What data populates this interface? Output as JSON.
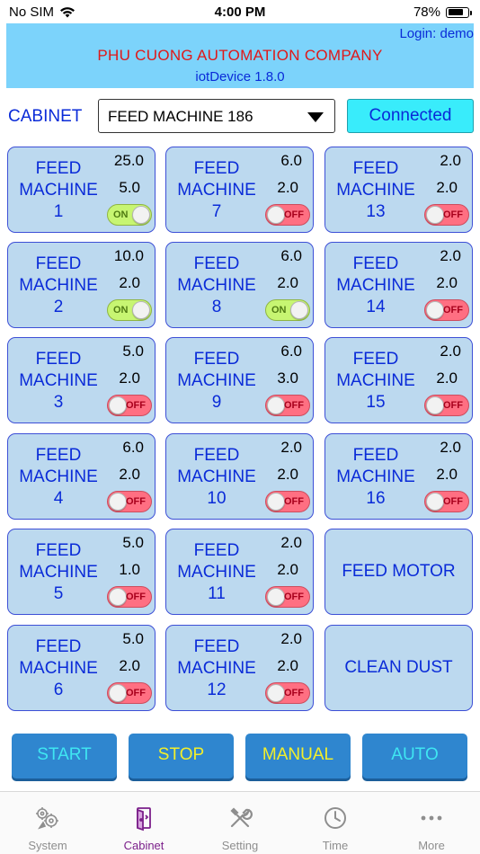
{
  "status_bar": {
    "carrier": "No SIM",
    "time": "4:00 PM",
    "battery": "78%"
  },
  "header": {
    "login": "Login: demo",
    "company": "PHU CUONG AUTOMATION COMPANY",
    "version": "iotDevice 1.8.0"
  },
  "cabinet": {
    "label": "CABINET",
    "selected": "FEED MACHINE 186",
    "status": "Connected"
  },
  "machines": [
    {
      "name": "FEED",
      "line2": "MACHINE",
      "number": "1",
      "val1": "25.0",
      "val2": "5.0",
      "state": "ON"
    },
    {
      "name": "FEED",
      "line2": "MACHINE",
      "number": "2",
      "val1": "10.0",
      "val2": "2.0",
      "state": "ON"
    },
    {
      "name": "FEED",
      "line2": "MACHINE",
      "number": "3",
      "val1": "5.0",
      "val2": "2.0",
      "state": "OFF"
    },
    {
      "name": "FEED",
      "line2": "MACHINE",
      "number": "4",
      "val1": "6.0",
      "val2": "2.0",
      "state": "OFF"
    },
    {
      "name": "FEED",
      "line2": "MACHINE",
      "number": "5",
      "val1": "5.0",
      "val2": "1.0",
      "state": "OFF"
    },
    {
      "name": "FEED",
      "line2": "MACHINE",
      "number": "6",
      "val1": "5.0",
      "val2": "2.0",
      "state": "OFF"
    },
    {
      "name": "FEED",
      "line2": "MACHINE",
      "number": "7",
      "val1": "6.0",
      "val2": "2.0",
      "state": "OFF"
    },
    {
      "name": "FEED",
      "line2": "MACHINE",
      "number": "8",
      "val1": "6.0",
      "val2": "2.0",
      "state": "ON"
    },
    {
      "name": "FEED",
      "line2": "MACHINE",
      "number": "9",
      "val1": "6.0",
      "val2": "3.0",
      "state": "OFF"
    },
    {
      "name": "FEED",
      "line2": "MACHINE",
      "number": "10",
      "val1": "2.0",
      "val2": "2.0",
      "state": "OFF"
    },
    {
      "name": "FEED",
      "line2": "MACHINE",
      "number": "11",
      "val1": "2.0",
      "val2": "2.0",
      "state": "OFF"
    },
    {
      "name": "FEED",
      "line2": "MACHINE",
      "number": "12",
      "val1": "2.0",
      "val2": "2.0",
      "state": "OFF"
    },
    {
      "name": "FEED",
      "line2": "MACHINE",
      "number": "13",
      "val1": "2.0",
      "val2": "2.0",
      "state": "OFF"
    },
    {
      "name": "FEED",
      "line2": "MACHINE",
      "number": "14",
      "val1": "2.0",
      "val2": "2.0",
      "state": "OFF"
    },
    {
      "name": "FEED",
      "line2": "MACHINE",
      "number": "15",
      "val1": "2.0",
      "val2": "2.0",
      "state": "OFF"
    },
    {
      "name": "FEED",
      "line2": "MACHINE",
      "number": "16",
      "val1": "2.0",
      "val2": "2.0",
      "state": "OFF"
    }
  ],
  "specials": {
    "feed_motor": "FEED MOTOR",
    "clean_dust": "CLEAN DUST"
  },
  "actions": {
    "start": {
      "label": "START",
      "color": "#3fe6f2"
    },
    "stop": {
      "label": "STOP",
      "color": "#f3ef2a"
    },
    "manual": {
      "label": "MANUAL",
      "color": "#f3ef2a"
    },
    "auto": {
      "label": "AUTO",
      "color": "#3fe6f2"
    }
  },
  "tabs": [
    {
      "label": "System",
      "icon": "system-icon"
    },
    {
      "label": "Cabinet",
      "icon": "cabinet-icon",
      "active": true
    },
    {
      "label": "Setting",
      "icon": "tools-icon"
    },
    {
      "label": "Time",
      "icon": "clock-icon"
    },
    {
      "label": "More",
      "icon": "more-icon"
    }
  ],
  "colors": {
    "accent_blue": "#0a2bd8",
    "banner": "#7cd3fb",
    "company_red": "#e01818",
    "tab_active": "#7b1f8a"
  }
}
